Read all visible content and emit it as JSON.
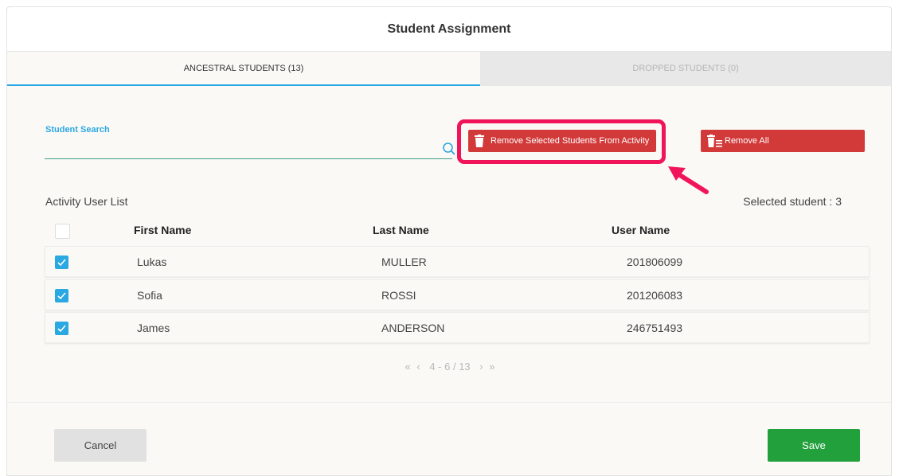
{
  "dialog": {
    "title": "Student Assignment"
  },
  "tabs": [
    {
      "label": "ANCESTRAL STUDENTS (13)",
      "active": true
    },
    {
      "label": "DROPPED STUDENTS (0)",
      "active": false
    }
  ],
  "search": {
    "label": "Student Search",
    "value": "",
    "placeholder": ""
  },
  "actions": {
    "remove_selected_label": "Remove Selected Students From Activity",
    "remove_all_label": "Remove All"
  },
  "list": {
    "title": "Activity User List",
    "selected_text": "Selected student : 3",
    "columns": [
      "First Name",
      "Last Name",
      "User Name"
    ],
    "rows": [
      {
        "first": "Lukas",
        "last": "MULLER",
        "user": "201806099",
        "checked": true
      },
      {
        "first": "Sofia",
        "last": "ROSSI",
        "user": "201206083",
        "checked": true
      },
      {
        "first": "James",
        "last": "ANDERSON",
        "user": "246751493",
        "checked": true
      }
    ]
  },
  "pagination": {
    "range": "4 - 6 / 13"
  },
  "footer": {
    "cancel_label": "Cancel",
    "save_label": "Save"
  },
  "colors": {
    "accent": "#2aa8e2",
    "danger": "#d23a3a",
    "success": "#22a03c",
    "highlight": "#f0155b"
  }
}
